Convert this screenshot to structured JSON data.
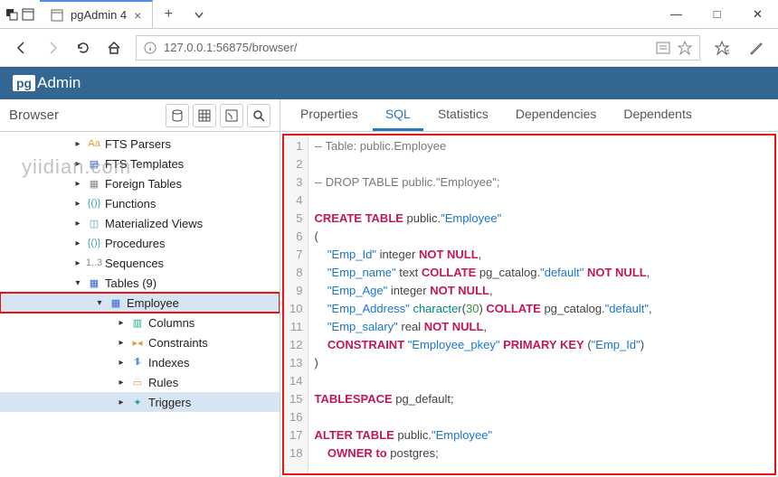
{
  "window": {
    "tab_title": "pgAdmin 4",
    "win_min": "—",
    "win_max": "□",
    "win_close": "✕"
  },
  "browser": {
    "url": "127.0.0.1:56875/browser/"
  },
  "header": {
    "logo_prefix": "pg",
    "logo_text": "Admin"
  },
  "side": {
    "title": "Browser",
    "items": [
      {
        "indent": 80,
        "arrow": ">",
        "icon": "Aa",
        "iconClass": "c-orange",
        "label": "FTS Parsers"
      },
      {
        "indent": 80,
        "arrow": ">",
        "icon": "▤",
        "iconClass": "c-blue",
        "label": "FTS Templates"
      },
      {
        "indent": 80,
        "arrow": ">",
        "icon": "▦",
        "iconClass": "c-gray",
        "label": "Foreign Tables"
      },
      {
        "indent": 80,
        "arrow": ">",
        "icon": "{()}",
        "iconClass": "c-teal",
        "label": "Functions"
      },
      {
        "indent": 80,
        "arrow": ">",
        "icon": "◫",
        "iconClass": "c-teal",
        "label": "Materialized Views"
      },
      {
        "indent": 80,
        "arrow": ">",
        "icon": "{()}",
        "iconClass": "c-teal",
        "label": "Procedures"
      },
      {
        "indent": 80,
        "arrow": ">",
        "icon": "1..3",
        "iconClass": "c-gray",
        "label": "Sequences"
      },
      {
        "indent": 80,
        "arrow": "v",
        "icon": "▦",
        "iconClass": "c-blue",
        "label": "Tables (9)"
      },
      {
        "indent": 104,
        "arrow": "v",
        "icon": "▦",
        "iconClass": "c-blue",
        "label": "Employee",
        "sel": true,
        "hl": true
      },
      {
        "indent": 128,
        "arrow": ">",
        "icon": "▥",
        "iconClass": "c-green",
        "label": "Columns"
      },
      {
        "indent": 128,
        "arrow": ">",
        "icon": "▸◂",
        "iconClass": "c-orange",
        "label": "Constraints"
      },
      {
        "indent": 128,
        "arrow": ">",
        "icon": "⥮",
        "iconClass": "c-blue",
        "label": "Indexes"
      },
      {
        "indent": 128,
        "arrow": ">",
        "icon": "▭",
        "iconClass": "c-orange",
        "label": "Rules"
      },
      {
        "indent": 128,
        "arrow": ">",
        "icon": "✦",
        "iconClass": "c-green",
        "label": "Triggers",
        "sel": true
      }
    ],
    "watermark": "yiidian.com"
  },
  "tabs": {
    "properties": "Properties",
    "sql": "SQL",
    "statistics": "Statistics",
    "dependencies": "Dependencies",
    "dependents": "Dependents"
  },
  "sql": {
    "lines": [
      {
        "n": 1,
        "segs": [
          {
            "c": "t-cmt",
            "t": "-- Table: public.Employee"
          }
        ]
      },
      {
        "n": 2,
        "segs": []
      },
      {
        "n": 3,
        "segs": [
          {
            "c": "t-cmt",
            "t": "-- DROP TABLE public.\"Employee\";"
          }
        ]
      },
      {
        "n": 4,
        "segs": []
      },
      {
        "n": 5,
        "segs": [
          {
            "c": "t-kw",
            "t": "CREATE TABLE"
          },
          {
            "c": "t-pl",
            "t": " public."
          },
          {
            "c": "t-str",
            "t": "\"Employee\""
          }
        ]
      },
      {
        "n": 6,
        "segs": [
          {
            "c": "t-pl",
            "t": "("
          }
        ]
      },
      {
        "n": 7,
        "segs": [
          {
            "c": "t-pl",
            "t": "    "
          },
          {
            "c": "t-str",
            "t": "\"Emp_Id\""
          },
          {
            "c": "t-pl",
            "t": " integer "
          },
          {
            "c": "t-kw",
            "t": "NOT NULL"
          },
          {
            "c": "t-pl",
            "t": ","
          }
        ]
      },
      {
        "n": 8,
        "segs": [
          {
            "c": "t-pl",
            "t": "    "
          },
          {
            "c": "t-str",
            "t": "\"Emp_name\""
          },
          {
            "c": "t-pl",
            "t": " text "
          },
          {
            "c": "t-kw",
            "t": "COLLATE"
          },
          {
            "c": "t-pl",
            "t": " pg_catalog."
          },
          {
            "c": "t-str",
            "t": "\"default\""
          },
          {
            "c": "t-pl",
            "t": " "
          },
          {
            "c": "t-kw",
            "t": "NOT NULL"
          },
          {
            "c": "t-pl",
            "t": ","
          }
        ]
      },
      {
        "n": 9,
        "segs": [
          {
            "c": "t-pl",
            "t": "    "
          },
          {
            "c": "t-str",
            "t": "\"Emp_Age\""
          },
          {
            "c": "t-pl",
            "t": " integer "
          },
          {
            "c": "t-kw",
            "t": "NOT NULL"
          },
          {
            "c": "t-pl",
            "t": ","
          }
        ]
      },
      {
        "n": 10,
        "segs": [
          {
            "c": "t-pl",
            "t": "    "
          },
          {
            "c": "t-str",
            "t": "\"Emp_Address\""
          },
          {
            "c": "t-pl",
            "t": " "
          },
          {
            "c": "t-fn",
            "t": "character"
          },
          {
            "c": "t-pl",
            "t": "("
          },
          {
            "c": "t-num",
            "t": "30"
          },
          {
            "c": "t-pl",
            "t": ") "
          },
          {
            "c": "t-kw",
            "t": "COLLATE"
          },
          {
            "c": "t-pl",
            "t": " pg_catalog."
          },
          {
            "c": "t-str",
            "t": "\"default\""
          },
          {
            "c": "t-pl",
            "t": ","
          }
        ]
      },
      {
        "n": 11,
        "segs": [
          {
            "c": "t-pl",
            "t": "    "
          },
          {
            "c": "t-str",
            "t": "\"Emp_salary\""
          },
          {
            "c": "t-pl",
            "t": " real "
          },
          {
            "c": "t-kw",
            "t": "NOT NULL"
          },
          {
            "c": "t-pl",
            "t": ","
          }
        ]
      },
      {
        "n": 12,
        "segs": [
          {
            "c": "t-pl",
            "t": "    "
          },
          {
            "c": "t-kw",
            "t": "CONSTRAINT"
          },
          {
            "c": "t-pl",
            "t": " "
          },
          {
            "c": "t-str",
            "t": "\"Employee_pkey\""
          },
          {
            "c": "t-pl",
            "t": " "
          },
          {
            "c": "t-kw",
            "t": "PRIMARY KEY"
          },
          {
            "c": "t-pl",
            "t": " ("
          },
          {
            "c": "t-str",
            "t": "\"Emp_Id\""
          },
          {
            "c": "t-pl",
            "t": ")"
          }
        ]
      },
      {
        "n": 13,
        "segs": [
          {
            "c": "t-pl",
            "t": ")"
          }
        ]
      },
      {
        "n": 14,
        "segs": []
      },
      {
        "n": 15,
        "segs": [
          {
            "c": "t-kw",
            "t": "TABLESPACE"
          },
          {
            "c": "t-pl",
            "t": " pg_default;"
          }
        ]
      },
      {
        "n": 16,
        "segs": []
      },
      {
        "n": 17,
        "segs": [
          {
            "c": "t-kw",
            "t": "ALTER TABLE"
          },
          {
            "c": "t-pl",
            "t": " public."
          },
          {
            "c": "t-str",
            "t": "\"Employee\""
          }
        ]
      },
      {
        "n": 18,
        "segs": [
          {
            "c": "t-pl",
            "t": "    "
          },
          {
            "c": "t-kw",
            "t": "OWNER to"
          },
          {
            "c": "t-pl",
            "t": " postgres;"
          }
        ]
      }
    ]
  }
}
